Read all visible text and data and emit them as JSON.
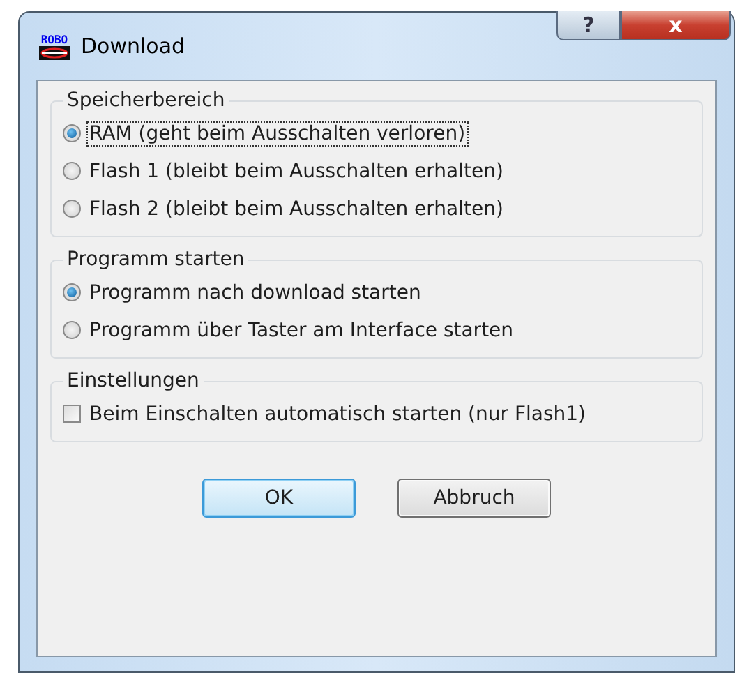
{
  "window": {
    "title": "Download",
    "logo_text": "ROBO",
    "help": "?",
    "close": "x"
  },
  "groups": [
    {
      "title": "Speicherbereich",
      "kind": "radio",
      "options": [
        {
          "label": "RAM (geht beim Ausschalten verloren)",
          "selected": true,
          "focused": true
        },
        {
          "label": "Flash 1 (bleibt beim Ausschalten erhalten)",
          "selected": false,
          "focused": false
        },
        {
          "label": "Flash 2 (bleibt beim Ausschalten erhalten)",
          "selected": false,
          "focused": false
        }
      ]
    },
    {
      "title": "Programm starten",
      "kind": "radio",
      "options": [
        {
          "label": "Programm nach download starten",
          "selected": true,
          "focused": false
        },
        {
          "label": "Programm über Taster am Interface starten",
          "selected": false,
          "focused": false
        }
      ]
    },
    {
      "title": "Einstellungen",
      "kind": "checkbox",
      "options": [
        {
          "label": "Beim Einschalten automatisch starten (nur Flash1)",
          "checked": false,
          "focused": false
        }
      ]
    }
  ],
  "buttons": [
    {
      "label": "OK",
      "default": true
    },
    {
      "label": "Abbruch",
      "default": false
    }
  ]
}
